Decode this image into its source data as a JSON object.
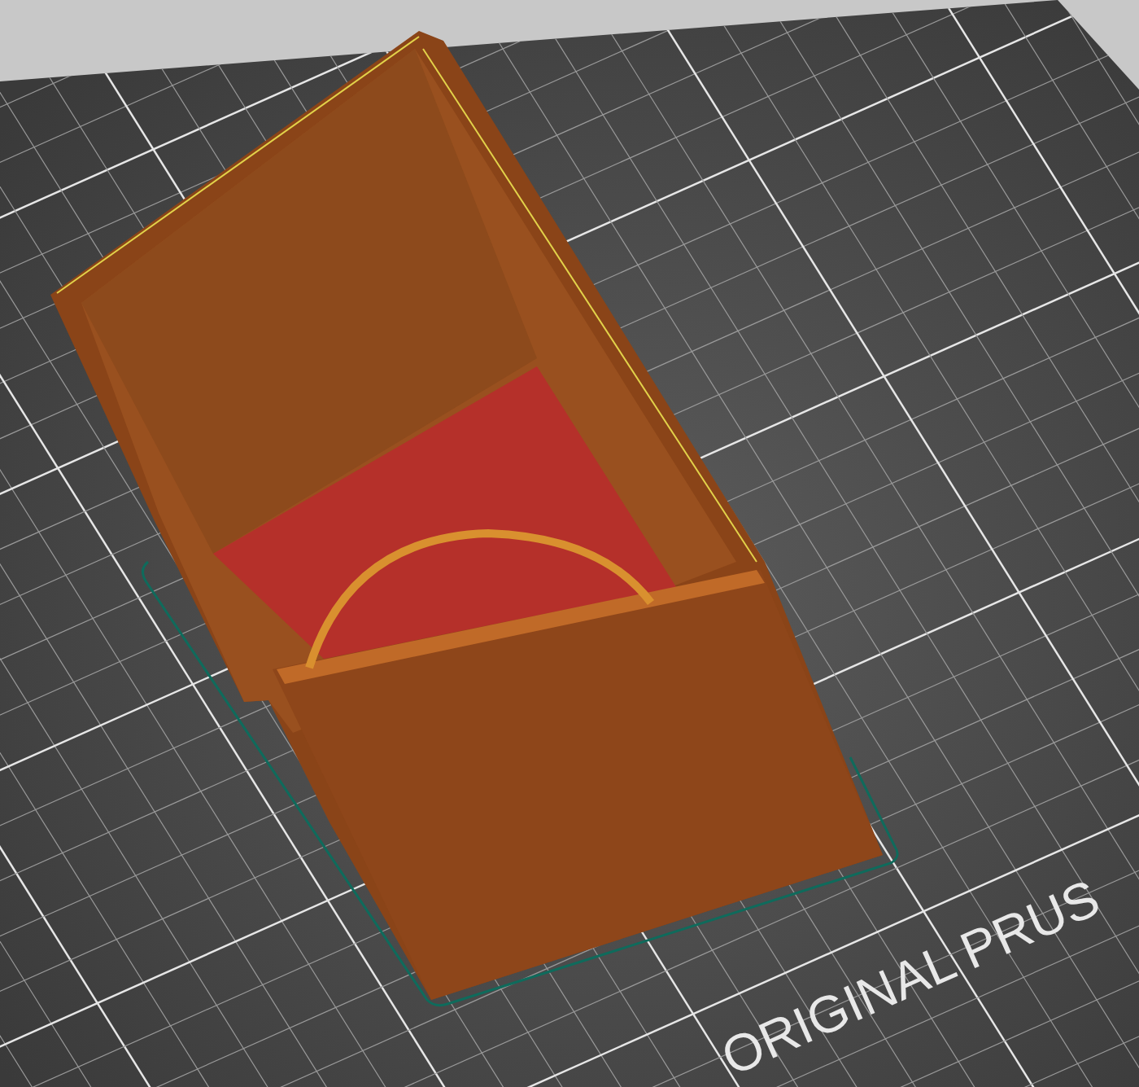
{
  "viewport": {
    "bed_label": "ORIGINAL PRUS"
  }
}
